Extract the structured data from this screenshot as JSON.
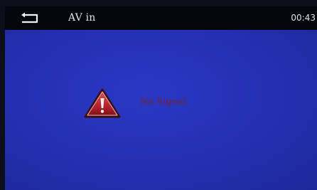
{
  "header": {
    "back_icon": "back-arrow-icon",
    "title": "AV in",
    "time": "00:43"
  },
  "main": {
    "status_icon": "warning-icon",
    "status_text": "No Signal"
  },
  "colors": {
    "background": "#2330b2",
    "header_bg": "#06070c",
    "status_text": "#7a1f2c",
    "warning_red": "#b8232b"
  }
}
